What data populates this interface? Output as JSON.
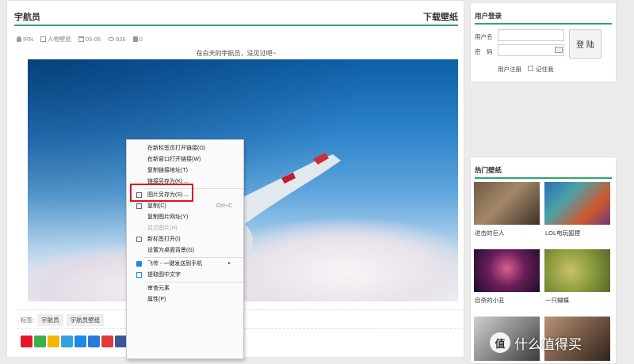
{
  "article": {
    "title": "宇航员",
    "download_link": "下载壁纸",
    "meta": {
      "author": "IRN",
      "category": "人物壁纸",
      "date": "05-06",
      "views": "836",
      "comments": "0"
    },
    "caption": "在白天的宇航员，没见过吧~",
    "tags_label": "标签:",
    "tags": [
      "宇航员",
      "宇航员壁纸"
    ],
    "share_icons": [
      {
        "icon": "weibo-icon",
        "color": "#e6162d"
      },
      {
        "icon": "wechat-icon",
        "color": "#3bb149"
      },
      {
        "icon": "qzone-icon",
        "color": "#f5b400"
      },
      {
        "icon": "tencent-weibo-icon",
        "color": "#2ea4da"
      },
      {
        "icon": "qq-icon",
        "color": "#1e88e5"
      },
      {
        "icon": "email-icon",
        "color": "#2a7bd6"
      },
      {
        "icon": "favorite-icon",
        "color": "#e33b3b"
      },
      {
        "icon": "facebook-icon",
        "color": "#3b5998"
      }
    ]
  },
  "context_menu": {
    "items": [
      {
        "label": "在新标签页打开链接(O)",
        "icon": ""
      },
      {
        "label": "在新窗口打开链接(W)",
        "icon": ""
      },
      {
        "label": "复制链接地址(T)",
        "icon": ""
      },
      {
        "label": "链接另存为(K) ...",
        "icon": ""
      },
      {
        "label": "图片另存为(S) ...",
        "icon": "save-image-icon"
      },
      {
        "label": "复制(C)",
        "icon": "copy-icon",
        "shortcut": "Ctrl+C"
      },
      {
        "label": "复制图片网址(Y)",
        "icon": ""
      },
      {
        "label": "显示图片(H)",
        "icon": "",
        "disabled": true
      },
      {
        "label": "新标签打开(I)",
        "icon": "new-tab-icon"
      },
      {
        "label": "设置为桌面背景(G)",
        "icon": ""
      },
      {
        "label": "飞传 - 一键发送到手机",
        "icon": "send-to-phone-icon",
        "submenu": "▸"
      },
      {
        "label": "提取图中文字",
        "icon": "extract-text-icon"
      },
      {
        "label": "审查元素",
        "icon": ""
      },
      {
        "label": "属性(P)",
        "icon": ""
      }
    ]
  },
  "login": {
    "heading": "用户登录",
    "username_label": "用户名",
    "password_label": "密　码",
    "username_value": "",
    "password_value": "",
    "submit": "登 陆",
    "register": "用户注册",
    "remember": "记住我"
  },
  "hot": {
    "heading": "热门壁纸",
    "items": [
      {
        "caption": "进击的巨人"
      },
      {
        "caption": "LOL电玩狐狸"
      },
      {
        "caption": "自杀的小丑"
      },
      {
        "caption": "一只蝴蝶"
      },
      {
        "caption": ""
      },
      {
        "caption": ""
      }
    ]
  },
  "watermark": {
    "badge": "值",
    "text": "什么值得买"
  }
}
